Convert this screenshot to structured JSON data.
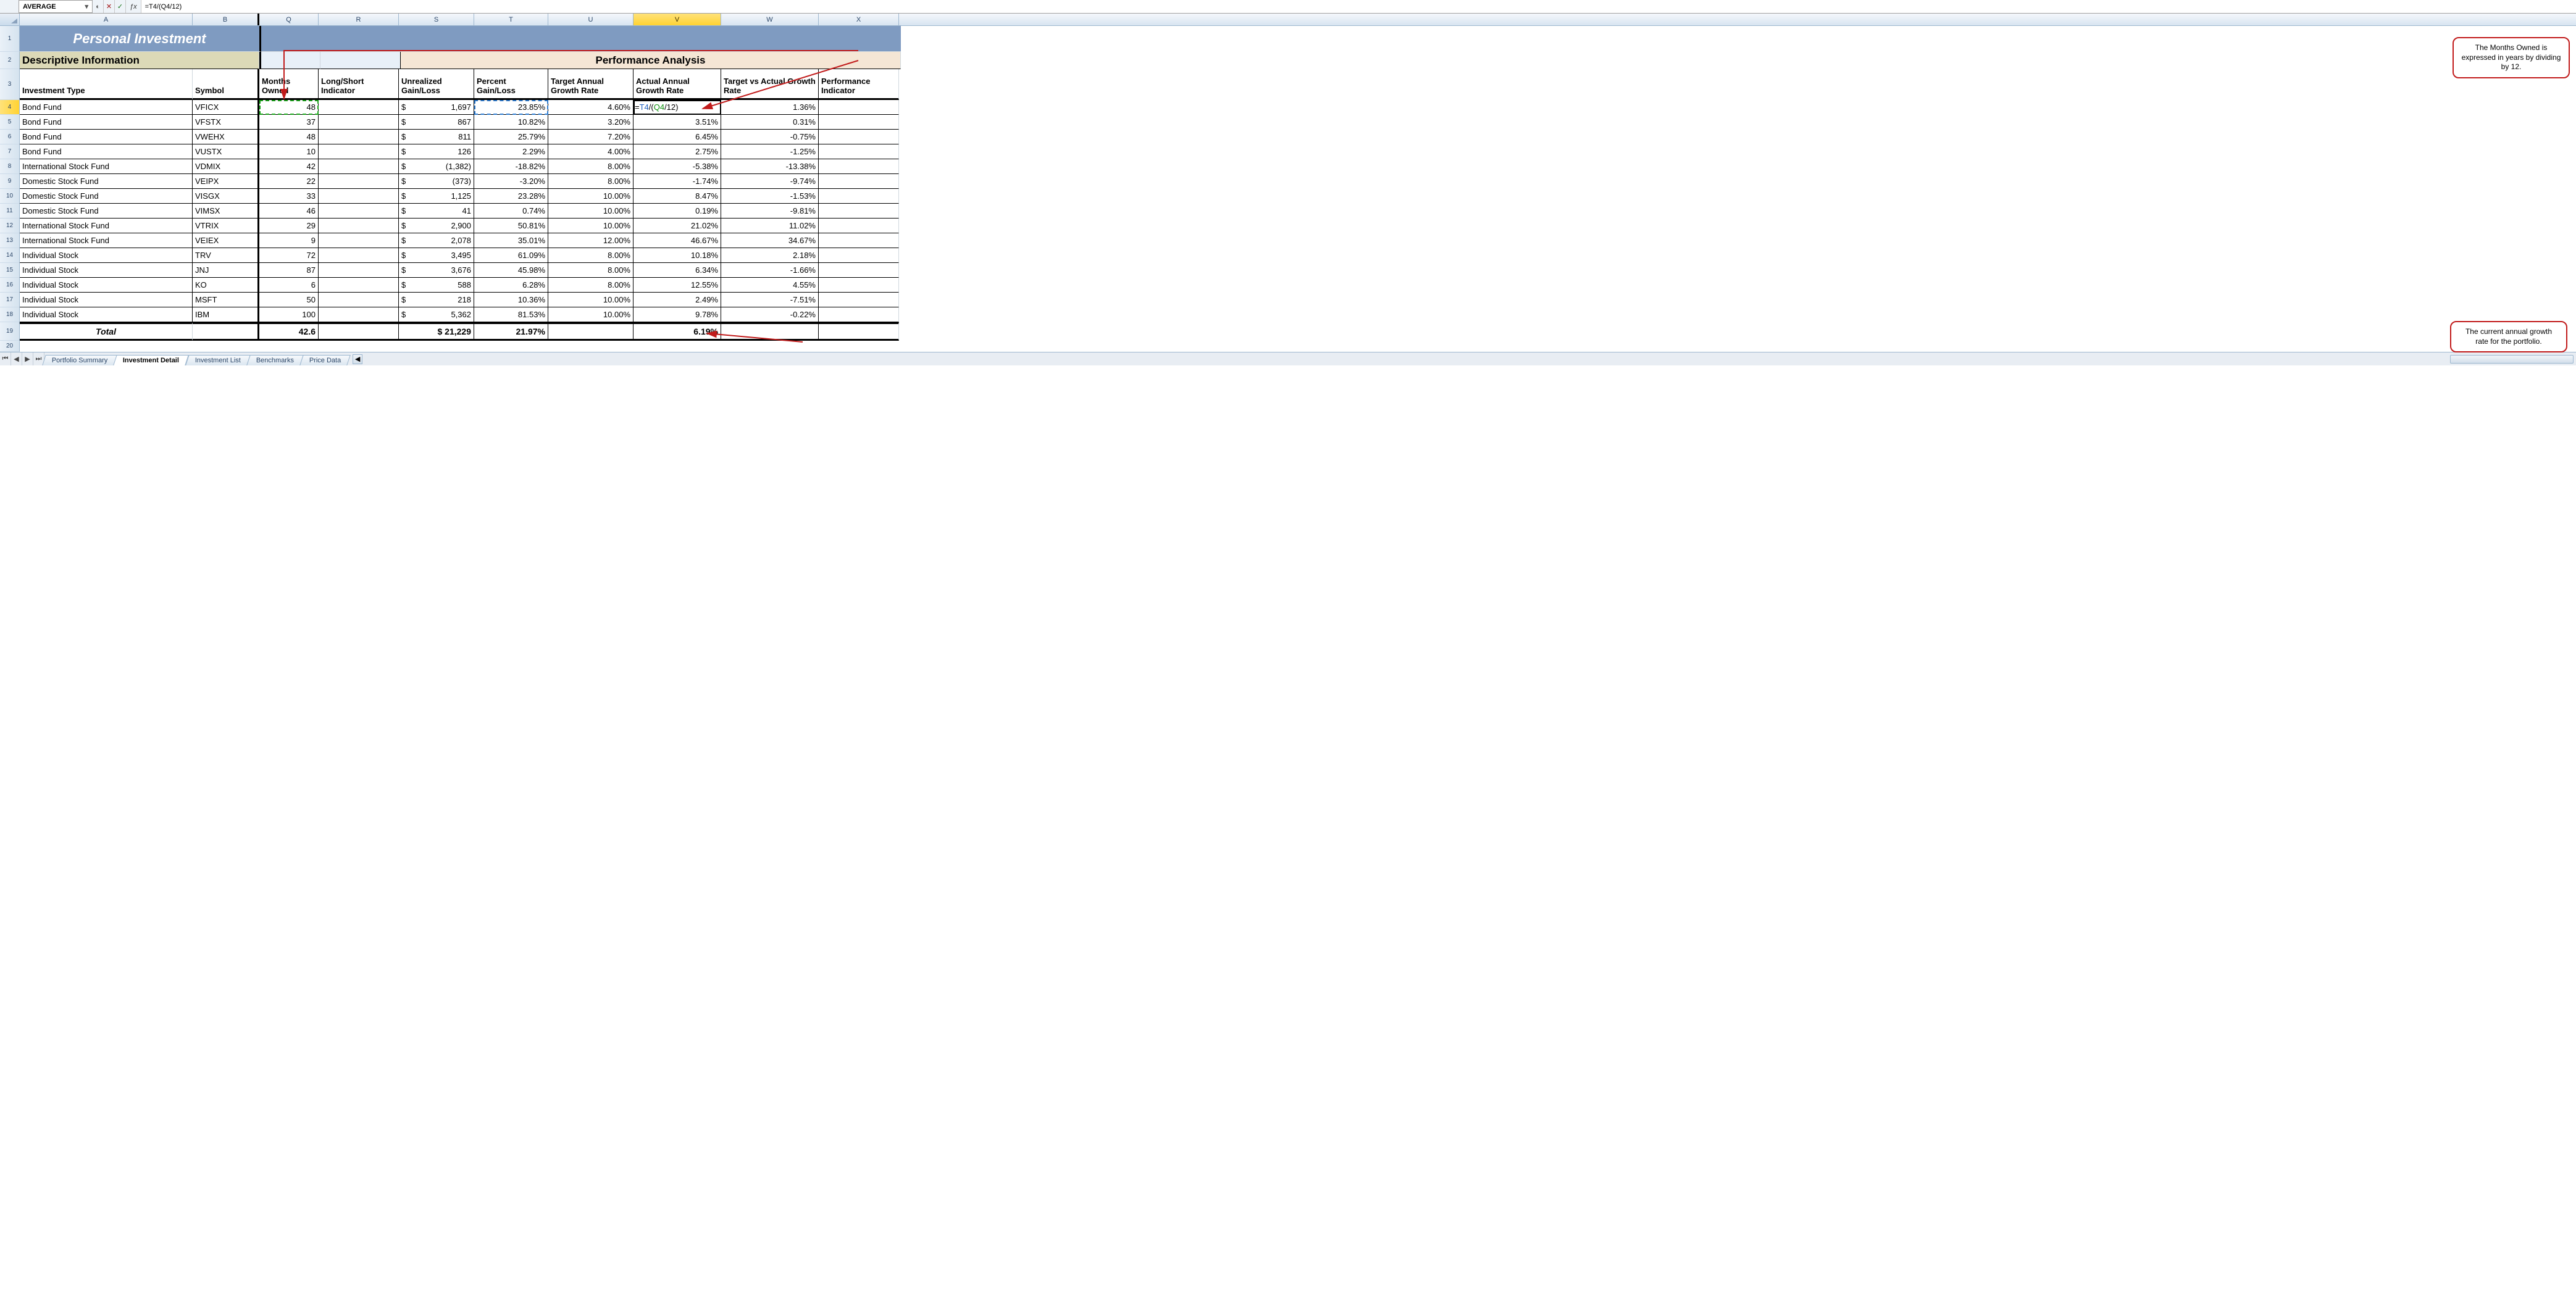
{
  "formula_bar": {
    "name_box": "AVERAGE",
    "formula": "=T4/(Q4/12)"
  },
  "columns": [
    "A",
    "B",
    "Q",
    "R",
    "S",
    "T",
    "U",
    "V",
    "W",
    "X"
  ],
  "active_col": "V",
  "row_headers_active": 4,
  "title": "Personal Investment",
  "sections": {
    "desc": "Descriptive Information",
    "perf": "Performance Analysis"
  },
  "col_labels": {
    "A": "Investment Type",
    "B": "Symbol",
    "Q": "Months Owned",
    "R": "Long/Short Indicator",
    "S": "Unrealized Gain/Loss",
    "T": "Percent Gain/Loss",
    "U": "Target Annual Growth Rate",
    "V": "Actual Annual Growth Rate",
    "W": "Target vs Actual Growth Rate",
    "X": "Performance Indicator"
  },
  "rows": [
    {
      "n": 4,
      "A": "Bond Fund",
      "B": "VFICX",
      "Q": "48",
      "S_sym": "$",
      "S": "1,697",
      "T": "23.85%",
      "U": "4.60%",
      "V_formula": "=T4/(Q4/12)",
      "W": "1.36%"
    },
    {
      "n": 5,
      "A": "Bond Fund",
      "B": "VFSTX",
      "Q": "37",
      "S_sym": "$",
      "S": "867",
      "T": "10.82%",
      "U": "3.20%",
      "V": "3.51%",
      "W": "0.31%"
    },
    {
      "n": 6,
      "A": "Bond Fund",
      "B": "VWEHX",
      "Q": "48",
      "S_sym": "$",
      "S": "811",
      "T": "25.79%",
      "U": "7.20%",
      "V": "6.45%",
      "W": "-0.75%"
    },
    {
      "n": 7,
      "A": "Bond Fund",
      "B": "VUSTX",
      "Q": "10",
      "S_sym": "$",
      "S": "126",
      "T": "2.29%",
      "U": "4.00%",
      "V": "2.75%",
      "W": "-1.25%"
    },
    {
      "n": 8,
      "A": "International Stock Fund",
      "B": "VDMIX",
      "Q": "42",
      "S_sym": "$",
      "S": "(1,382)",
      "T": "-18.82%",
      "U": "8.00%",
      "V": "-5.38%",
      "W": "-13.38%"
    },
    {
      "n": 9,
      "A": "Domestic Stock Fund",
      "B": "VEIPX",
      "Q": "22",
      "S_sym": "$",
      "S": "(373)",
      "T": "-3.20%",
      "U": "8.00%",
      "V": "-1.74%",
      "W": "-9.74%"
    },
    {
      "n": 10,
      "A": "Domestic Stock Fund",
      "B": "VISGX",
      "Q": "33",
      "S_sym": "$",
      "S": "1,125",
      "T": "23.28%",
      "U": "10.00%",
      "V": "8.47%",
      "W": "-1.53%"
    },
    {
      "n": 11,
      "A": "Domestic Stock Fund",
      "B": "VIMSX",
      "Q": "46",
      "S_sym": "$",
      "S": "41",
      "T": "0.74%",
      "U": "10.00%",
      "V": "0.19%",
      "W": "-9.81%"
    },
    {
      "n": 12,
      "A": "International Stock Fund",
      "B": "VTRIX",
      "Q": "29",
      "S_sym": "$",
      "S": "2,900",
      "T": "50.81%",
      "U": "10.00%",
      "V": "21.02%",
      "W": "11.02%"
    },
    {
      "n": 13,
      "A": "International Stock Fund",
      "B": "VEIEX",
      "Q": "9",
      "S_sym": "$",
      "S": "2,078",
      "T": "35.01%",
      "U": "12.00%",
      "V": "46.67%",
      "W": "34.67%"
    },
    {
      "n": 14,
      "A": "Individual Stock",
      "B": "TRV",
      "Q": "72",
      "S_sym": "$",
      "S": "3,495",
      "T": "61.09%",
      "U": "8.00%",
      "V": "10.18%",
      "W": "2.18%"
    },
    {
      "n": 15,
      "A": "Individual Stock",
      "B": "JNJ",
      "Q": "87",
      "S_sym": "$",
      "S": "3,676",
      "T": "45.98%",
      "U": "8.00%",
      "V": "6.34%",
      "W": "-1.66%"
    },
    {
      "n": 16,
      "A": "Individual Stock",
      "B": "KO",
      "Q": "6",
      "S_sym": "$",
      "S": "588",
      "T": "6.28%",
      "U": "8.00%",
      "V": "12.55%",
      "W": "4.55%"
    },
    {
      "n": 17,
      "A": "Individual Stock",
      "B": "MSFT",
      "Q": "50",
      "S_sym": "$",
      "S": "218",
      "T": "10.36%",
      "U": "10.00%",
      "V": "2.49%",
      "W": "-7.51%"
    },
    {
      "n": 18,
      "A": "Individual Stock",
      "B": "IBM",
      "Q": "100",
      "S_sym": "$",
      "S": "5,362",
      "T": "81.53%",
      "U": "10.00%",
      "V": "9.78%",
      "W": "-0.22%"
    }
  ],
  "total": {
    "label": "Total",
    "Q": "42.6",
    "S": "$ 21,229",
    "T": "21.97%",
    "V": "6.19%"
  },
  "tabs": [
    "Portfolio Summary",
    "Investment Detail",
    "Investment List",
    "Benchmarks",
    "Price Data"
  ],
  "active_tab": "Investment Detail",
  "callouts": {
    "top": "The Months Owned is expressed in years by dividing by 12.",
    "bottom": "The current annual growth rate for the portfolio."
  },
  "row_numbers_extra": {
    "total": 19,
    "blank": 20
  }
}
